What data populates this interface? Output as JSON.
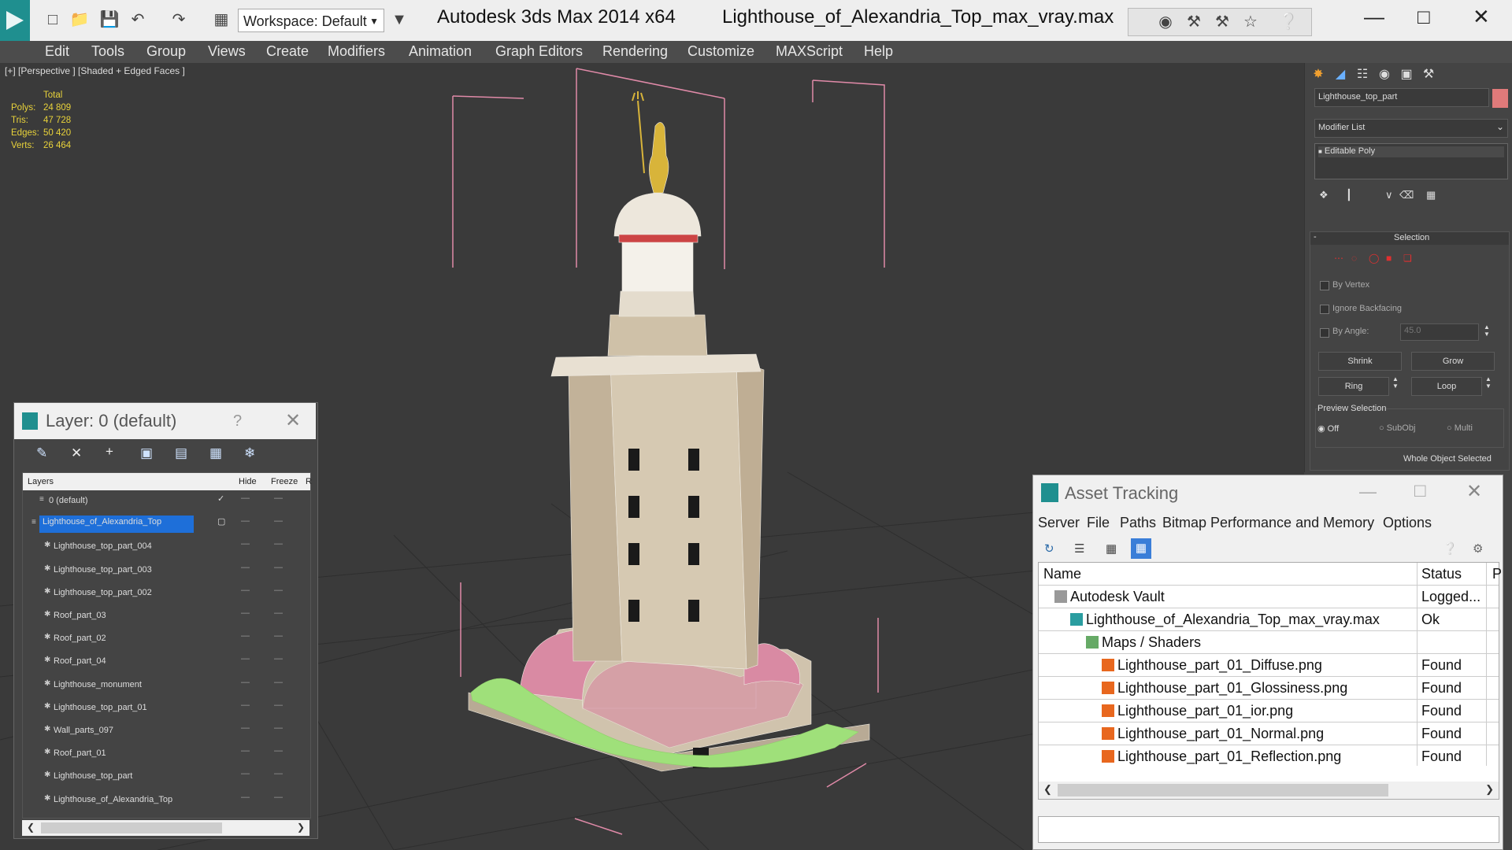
{
  "window": {
    "app_title": "Autodesk 3ds Max  2014 x64",
    "file_title": "Lighthouse_of_Alexandria_Top_max_vray.max",
    "workspace_label": "Workspace: Default"
  },
  "menu": [
    "Edit",
    "Tools",
    "Group",
    "Views",
    "Create",
    "Modifiers",
    "Animation",
    "Graph Editors",
    "Rendering",
    "Customize",
    "MAXScript",
    "Help"
  ],
  "viewport": {
    "label": "[+] [Perspective ] [Shaded + Edged Faces ]",
    "stats": {
      "header": "Total",
      "polys_label": "Polys:",
      "polys": "24 809",
      "tris_label": "Tris:",
      "tris": "47 728",
      "edges_label": "Edges:",
      "edges": "50 420",
      "verts_label": "Verts:",
      "verts": "26 464"
    }
  },
  "command_panel": {
    "object_name": "Lighthouse_top_part",
    "object_color": "#e07a7a",
    "modifier_list": "Modifier List",
    "stack_item": "Editable Poly",
    "selection_title": "Selection",
    "by_vertex": "By Vertex",
    "ignore_backfacing": "Ignore Backfacing",
    "by_angle": "By Angle:",
    "angle_value": "45.0",
    "shrink": "Shrink",
    "grow": "Grow",
    "ring": "Ring",
    "loop": "Loop",
    "preview_selection": "Preview Selection",
    "off": "Off",
    "subobj": "SubObj",
    "multi": "Multi",
    "whole_object": "Whole Object Selected"
  },
  "layer_dialog": {
    "title": "Layer: 0 (default)",
    "help": "?",
    "col_layers": "Layers",
    "col_hide": "Hide",
    "col_freeze": "Freeze",
    "col_r": "R",
    "rows": [
      {
        "name": "0 (default)"
      },
      {
        "name": "Lighthouse_of_Alexandria_Top"
      },
      {
        "name": "Lighthouse_top_part_004"
      },
      {
        "name": "Lighthouse_top_part_003"
      },
      {
        "name": "Lighthouse_top_part_002"
      },
      {
        "name": "Roof_part_03"
      },
      {
        "name": "Roof_part_02"
      },
      {
        "name": "Roof_part_04"
      },
      {
        "name": "Lighthouse_monument"
      },
      {
        "name": "Lighthouse_top_part_01"
      },
      {
        "name": "Wall_parts_097"
      },
      {
        "name": "Roof_part_01"
      },
      {
        "name": "Lighthouse_top_part"
      },
      {
        "name": "Lighthouse_of_Alexandria_Top"
      }
    ],
    "selected_color": "#1e6fd9"
  },
  "asset_tracking": {
    "title": "Asset Tracking",
    "menu": [
      "Server",
      "File",
      "Paths",
      "Bitmap Performance and Memory",
      "Options"
    ],
    "col_name": "Name",
    "col_status": "Status",
    "col_p": "P",
    "rows": [
      {
        "name": "Autodesk Vault",
        "status": "Logged..."
      },
      {
        "name": "Lighthouse_of_Alexandria_Top_max_vray.max",
        "status": "Ok"
      },
      {
        "name": "Maps / Shaders",
        "status": ""
      },
      {
        "name": "Lighthouse_part_01_Diffuse.png",
        "status": "Found"
      },
      {
        "name": "Lighthouse_part_01_Glossiness.png",
        "status": "Found"
      },
      {
        "name": "Lighthouse_part_01_ior.png",
        "status": "Found"
      },
      {
        "name": "Lighthouse_part_01_Normal.png",
        "status": "Found"
      },
      {
        "name": "Lighthouse_part_01_Reflection.png",
        "status": "Found"
      }
    ]
  }
}
